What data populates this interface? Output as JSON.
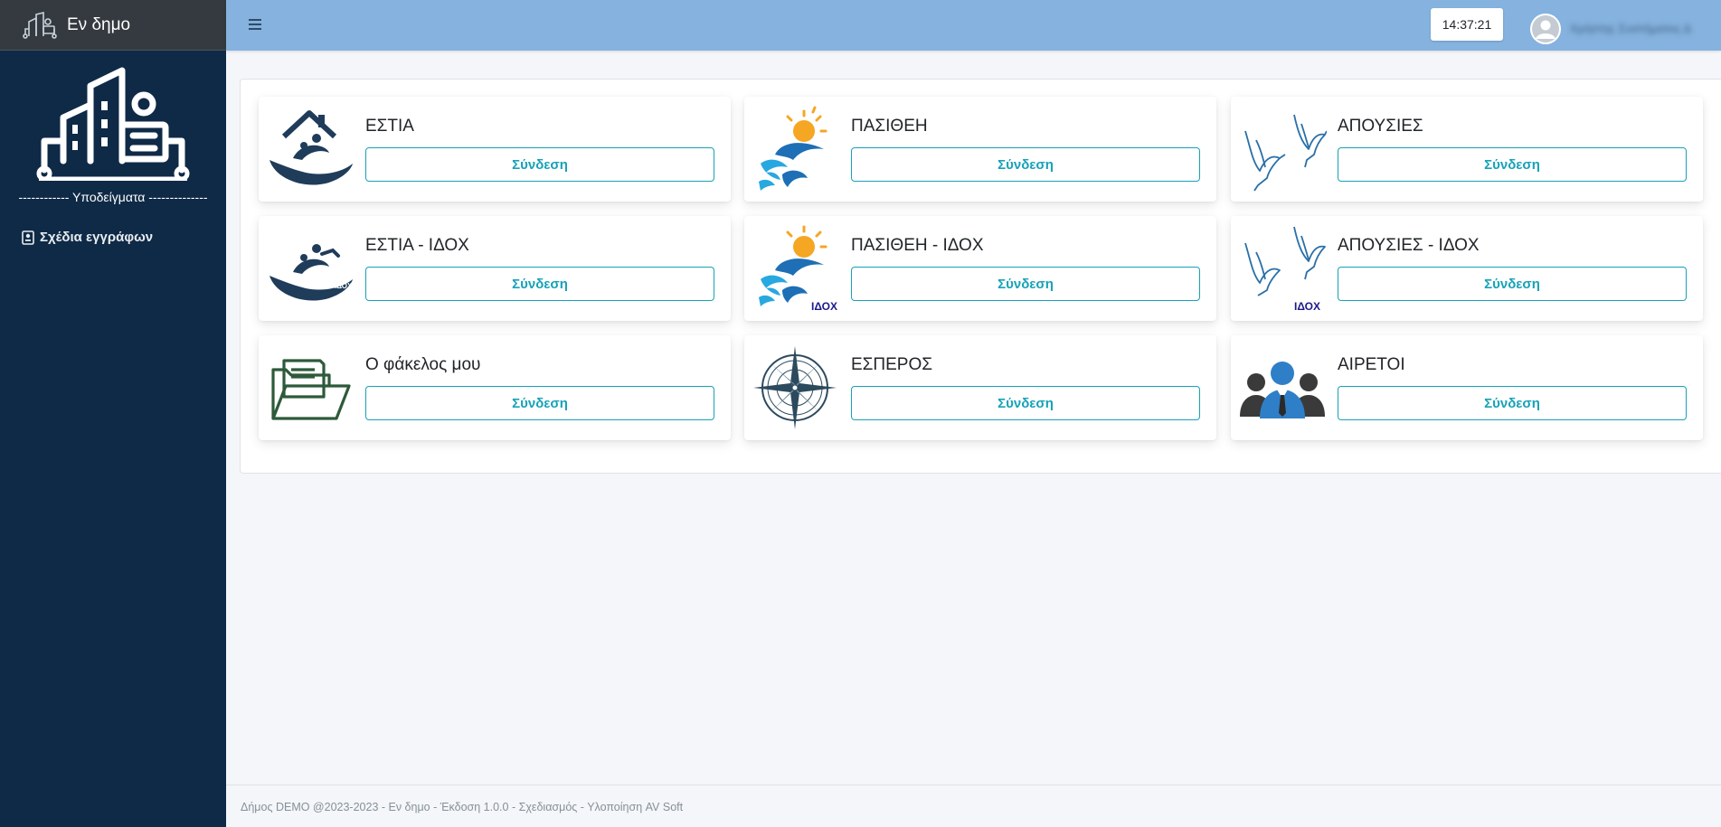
{
  "brand": {
    "name": "Εν δημο"
  },
  "sidebar": {
    "separator": "------------ Υποδείγματα --------------",
    "items": [
      {
        "label": "Σχέδια εγγράφων",
        "icon": "document-icon"
      }
    ]
  },
  "header": {
    "clock": "14:37:21",
    "username": "Χρήστης Συστήματος Δ"
  },
  "apps": [
    {
      "id": "estia",
      "title": "ΕΣΤΙΑ",
      "button": "Σύνδεση"
    },
    {
      "id": "pasithei",
      "title": "ΠΑΣΙΘΕΗ",
      "button": "Σύνδεση"
    },
    {
      "id": "apousies",
      "title": "ΑΠΟΥΣΙΕΣ",
      "button": "Σύνδεση"
    },
    {
      "id": "estia-idox",
      "title": "ΕΣΤΙΑ - ΙΔΟΧ",
      "button": "Σύνδεση",
      "badge": "ΙΔΟΧ"
    },
    {
      "id": "pasithei-idox",
      "title": "ΠΑΣΙΘΕΗ - ΙΔΟΧ",
      "button": "Σύνδεση",
      "badge": "ΙΔΟΧ"
    },
    {
      "id": "apousies-idox",
      "title": "ΑΠΟΥΣΙΕΣ - ΙΔΟΧ",
      "button": "Σύνδεση",
      "badge": "ΙΔΟΧ"
    },
    {
      "id": "fakelos",
      "title": "Ο φάκελος μου",
      "button": "Σύνδεση"
    },
    {
      "id": "esperos",
      "title": "ΕΣΠΕΡΟΣ",
      "button": "Σύνδεση"
    },
    {
      "id": "airetoi",
      "title": "ΑΙΡΕΤΟΙ",
      "button": "Σύνδεση"
    }
  ],
  "footer": {
    "text": "Δήμος DEMO @2023-2023 - Εν δημο - Έκδοση 1.0.0 - Σχεδιασμός - Υλοποίηση AV Soft"
  },
  "colors": {
    "sidebar": "#0f2a47",
    "header": "#85b2df",
    "accent": "#17a2b8",
    "brand_bar": "#343a40"
  }
}
